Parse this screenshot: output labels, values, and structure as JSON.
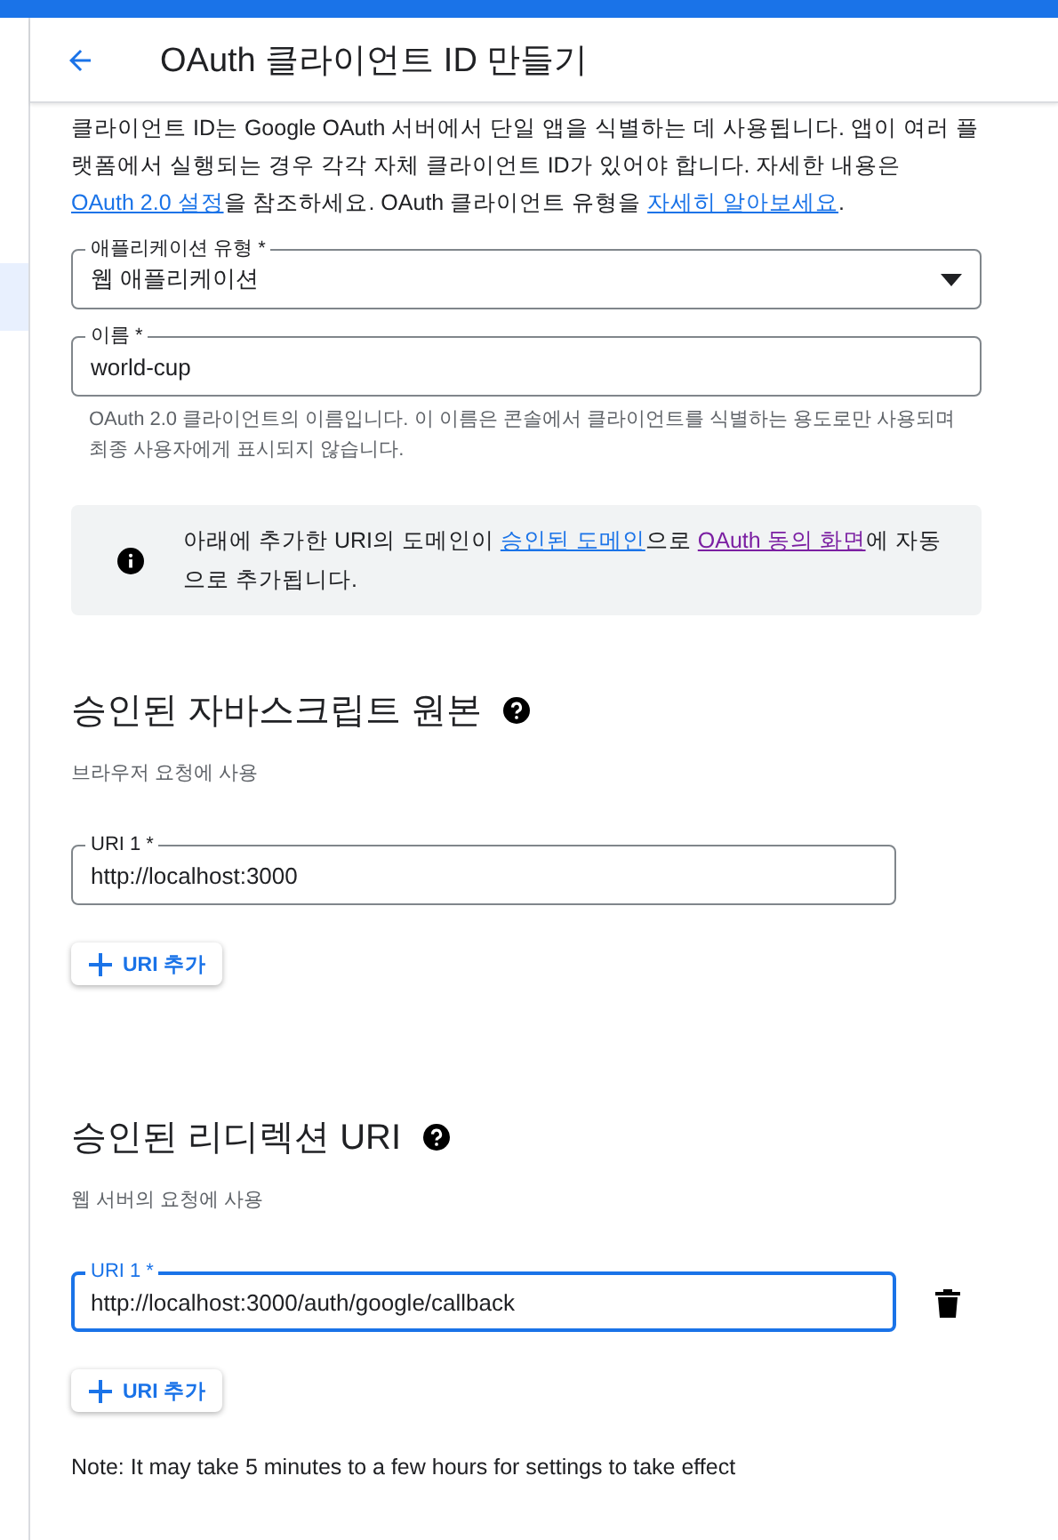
{
  "header": {
    "title": "OAuth 클라이언트 ID 만들기"
  },
  "intro": [
    {
      "text": "클라이언트 ID는 Google OAuth 서버에서 단일 앱을 식별하는 데 사용됩니다. 앱이 여러 플랫폼에서 실행되는 경우 각각 자체 클라이언트 ID가 있어야 합니다. 자세한 내용은 "
    },
    {
      "text": "OAuth 2.0 설정",
      "link": true,
      "visited": false
    },
    {
      "text": "을 참조하세요. OAuth 클라이언트 유형을 "
    },
    {
      "text": "자세히 알아보세요",
      "link": true,
      "visited": false
    },
    {
      "text": "."
    }
  ],
  "fields": [
    {
      "kind": "select",
      "label": "애플리케이션 유형 *",
      "value": "웹 애플리케이션"
    },
    {
      "kind": "text",
      "label": "이름 *",
      "value": "world-cup",
      "helper": "OAuth 2.0 클라이언트의 이름입니다. 이 이름은 콘솔에서 클라이언트를 식별하는 용도로만 사용되며 최종 사용자에게 표시되지 않습니다."
    }
  ],
  "info": [
    {
      "text": "아래에 추가한 URI의 도메인이 "
    },
    {
      "text": "승인된 도메인",
      "link": true,
      "visited": false
    },
    {
      "text": "으로 "
    },
    {
      "text": "OAuth 동의 화면",
      "link": true,
      "visited": true
    },
    {
      "text": "에 자동으로 추가됩니다."
    }
  ],
  "sections": [
    {
      "title": "승인된 자바스크립트 원본",
      "subtitle": "브라우저 요청에 사용",
      "uris": [
        {
          "label": "URI 1 *",
          "value": "http://localhost:3000",
          "focused": false,
          "removable": false
        }
      ],
      "add_button": "URI 추가"
    },
    {
      "title": "승인된 리디렉션 URI",
      "subtitle": "웹 서버의 요청에 사용",
      "uris": [
        {
          "label": "URI 1 *",
          "value": "http://localhost:3000/auth/google/callback",
          "focused": true,
          "removable": true
        }
      ],
      "add_button": "URI 추가"
    }
  ],
  "note": "Note: It may take 5 minutes to a few hours for settings to take effect"
}
